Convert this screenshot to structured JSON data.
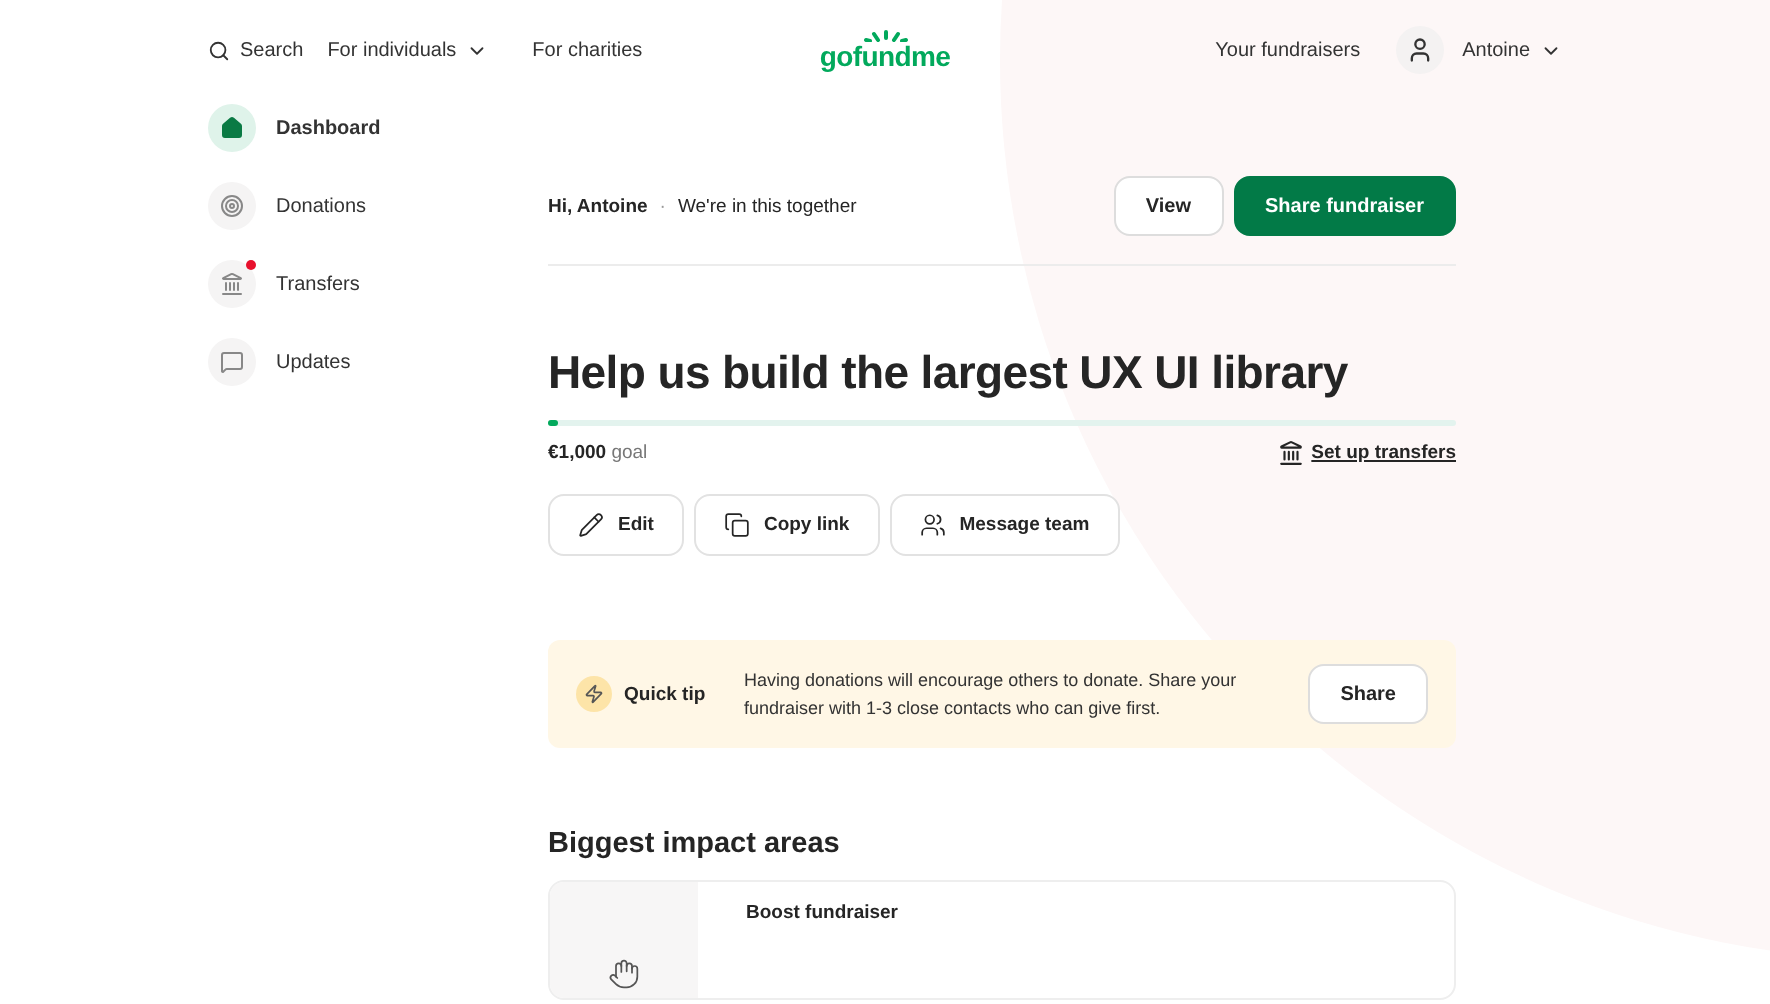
{
  "header": {
    "search": "Search",
    "nav": [
      {
        "label": "For individuals",
        "dropdown": true
      },
      {
        "label": "For charities",
        "dropdown": false
      }
    ],
    "logo": "gofundme",
    "your_fundraisers": "Your fundraisers",
    "user": "Antoine"
  },
  "sidebar": {
    "items": [
      {
        "label": "Dashboard",
        "kind": "home",
        "selected": true,
        "notification": false
      },
      {
        "label": "Donations",
        "kind": "donations",
        "selected": false,
        "notification": false
      },
      {
        "label": "Transfers",
        "kind": "bank",
        "selected": false,
        "notification": true
      },
      {
        "label": "Updates",
        "kind": "updates",
        "selected": false,
        "notification": false
      }
    ]
  },
  "greeting": {
    "name": "Hi, Antoine",
    "separator": "·",
    "tagline": "We're in this together"
  },
  "top_buttons": [
    {
      "label": "View",
      "primary": false
    },
    {
      "label": "Share fundraiser",
      "primary": true
    }
  ],
  "fundraiser": {
    "title": "Help us build the largest UX UI library",
    "progress": {
      "level": 0.01
    },
    "amount": "€1,000",
    "goal_label": "goal",
    "transfers_link": "Set up transfers"
  },
  "actions": [
    {
      "label": "Edit",
      "kind": "edit"
    },
    {
      "label": "Copy link",
      "kind": "copy"
    },
    {
      "label": "Message team",
      "kind": "team"
    }
  ],
  "tip": {
    "title": "Quick tip",
    "text": "Having donations will encourage others to donate. Share your fundraiser with 1-3 close contacts who can give first.",
    "button": "Share"
  },
  "impact": {
    "heading": "Biggest impact areas",
    "cards": [
      {
        "title": "Boost fundraiser"
      }
    ]
  }
}
